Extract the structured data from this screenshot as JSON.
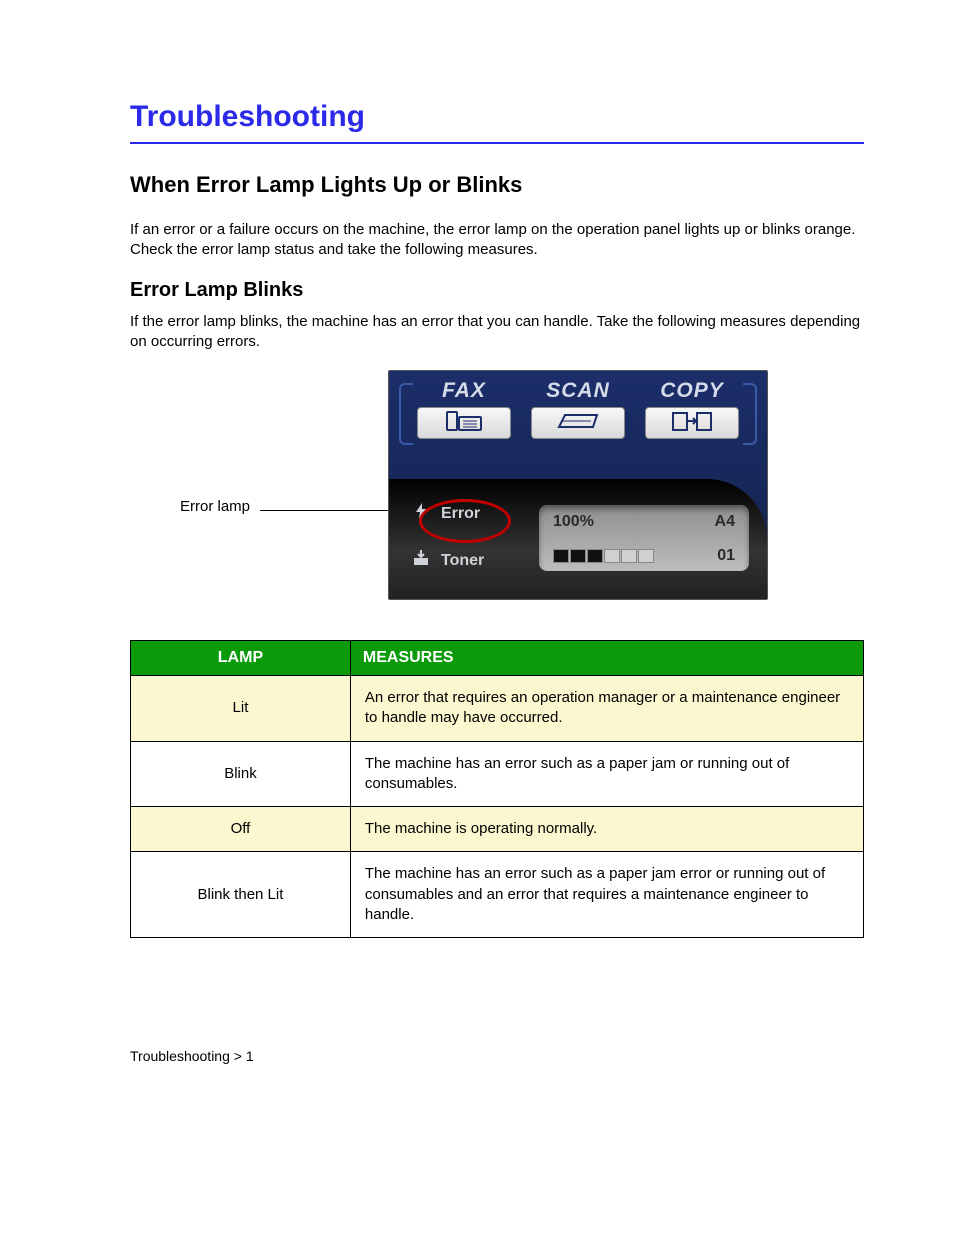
{
  "title": "Troubleshooting",
  "section": "When Error Lamp Lights Up or Blinks",
  "subsection": "Error Lamp Blinks",
  "paragraphs": {
    "p1": "If an error or a failure occurs on the machine, the error lamp on the operation panel lights up or blinks orange. Check the error lamp status and take the following measures.",
    "p2": "If the error lamp blinks, the machine has an error that you can handle. Take the following measures depending on occurring errors."
  },
  "figure": {
    "label": "Error lamp",
    "modes": {
      "fax": "FAX",
      "scan": "SCAN",
      "copy": "COPY"
    },
    "indicators": {
      "error": "Error",
      "toner": "Toner"
    },
    "lcd": {
      "zoom": "100%",
      "paper": "A4",
      "tray": "01",
      "filled_bars": 3,
      "total_bars": 6
    }
  },
  "table": {
    "headers": {
      "lamp": "LAMP",
      "measures": "MEASURES"
    },
    "rows": [
      {
        "lamp": "Lit",
        "measures": "An error that requires an operation manager or a maintenance engineer to handle may have occurred."
      },
      {
        "lamp": "Blink",
        "measures": "The machine has an error such as a paper jam or running out of consumables."
      },
      {
        "lamp": "Off",
        "measures": "The machine is operating normally."
      },
      {
        "lamp": "Blink then Lit",
        "measures": "The machine has an error such as a paper jam error or running out of consumables and an error that requires a maintenance engineer to handle."
      }
    ]
  },
  "footer": "Troubleshooting > 1"
}
